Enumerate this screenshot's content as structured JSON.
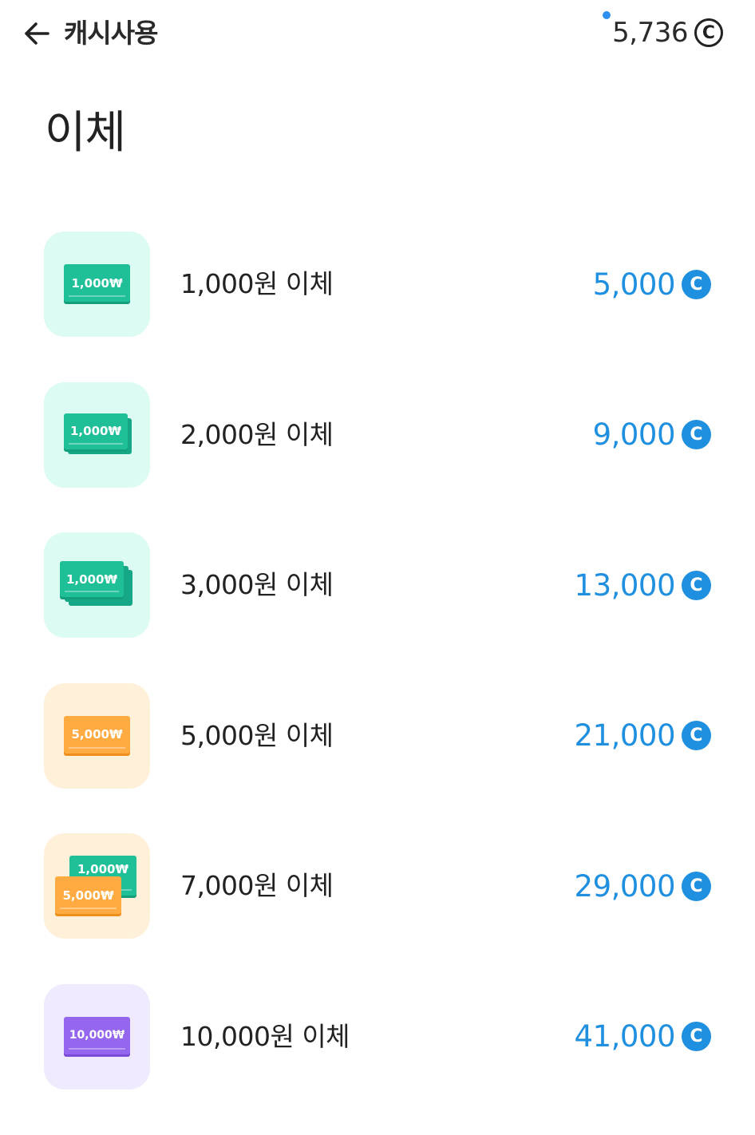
{
  "header": {
    "title": "캐시사용",
    "back_icon": "arrow-left-icon",
    "balance": "5,736",
    "balance_icon": "coin-c-icon",
    "coin_symbol": "C"
  },
  "page": {
    "title": "이체"
  },
  "items": [
    {
      "label": "1,000원 이체",
      "price": "5,000",
      "icon_color": "green",
      "bill_text": "1,000₩"
    },
    {
      "label": "2,000원 이체",
      "price": "9,000",
      "icon_color": "green",
      "bill_text": "1,000₩"
    },
    {
      "label": "3,000원 이체",
      "price": "13,000",
      "icon_color": "green",
      "bill_text": "1,000₩"
    },
    {
      "label": "5,000원 이체",
      "price": "21,000",
      "icon_color": "orange",
      "bill_text": "5,000₩"
    },
    {
      "label": "7,000원 이체",
      "price": "29,000",
      "icon_color": "orange",
      "bill_text": "5,000₩",
      "bill_back_text": "1,000₩"
    },
    {
      "label": "10,000원 이체",
      "price": "41,000",
      "icon_color": "purple",
      "bill_text": "10,000₩"
    }
  ],
  "colors": {
    "accent_blue": "#1f8fe0",
    "green_bill": "#1fbf97",
    "orange_bill": "#ffab42",
    "purple_bill": "#9566ee"
  }
}
